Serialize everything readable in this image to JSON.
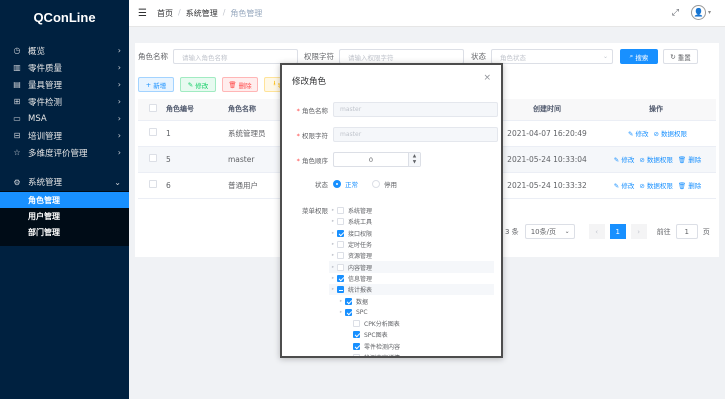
{
  "app": {
    "title": "QConLine"
  },
  "sidebar": {
    "items": [
      {
        "label": "概览",
        "icon": "dashboard-icon"
      },
      {
        "label": "零件质量",
        "icon": "chart-icon"
      },
      {
        "label": "量具管理",
        "icon": "ruler-icon"
      },
      {
        "label": "零件检测",
        "icon": "inspect-icon"
      },
      {
        "label": "MSA",
        "icon": "msa-icon"
      },
      {
        "label": "培训管理",
        "icon": "training-icon"
      },
      {
        "label": "多维度评价管理",
        "icon": "star-icon"
      }
    ],
    "system": {
      "label": "系统管理",
      "icon": "gear-icon"
    },
    "sub_items": [
      {
        "label": "角色管理",
        "active": true
      },
      {
        "label": "用户管理",
        "active": false
      },
      {
        "label": "部门管理",
        "active": false
      }
    ]
  },
  "header": {
    "breadcrumb": [
      "首页",
      "系统管理",
      "角色管理"
    ],
    "separator": "/"
  },
  "search": {
    "role_name_label": "角色名称",
    "role_name_placeholder": "请输入角色名称",
    "perm_label": "权限字符",
    "perm_placeholder": "请输入权限字符",
    "status_label": "状态",
    "status_placeholder": "角色状态",
    "search_btn": "搜索",
    "reset_btn": "重置"
  },
  "toolbar": {
    "add": "新增",
    "edit": "修改",
    "delete": "删除",
    "export": "导出"
  },
  "table": {
    "headers": [
      "角色编号",
      "角色名称",
      "创建时间",
      "操作"
    ],
    "rows": [
      {
        "id": "1",
        "name": "系统管理员",
        "created": "2021-04-07 16:20:49",
        "ops": [
          "修改",
          "数据权限"
        ]
      },
      {
        "id": "5",
        "name": "master",
        "created": "2021-05-24 10:33:04",
        "ops": [
          "修改",
          "数据权限",
          "删除"
        ]
      },
      {
        "id": "6",
        "name": "普通用户",
        "created": "2021-05-24 10:33:32",
        "ops": [
          "修改",
          "数据权限",
          "删除"
        ]
      }
    ]
  },
  "pager": {
    "total": "3 条",
    "size": "10条/页",
    "page": "1",
    "goto": "前往",
    "goto_val": "1",
    "unit": "页"
  },
  "dialog": {
    "title": "修改角色",
    "close": "×",
    "fields": {
      "name_label": "角色名称",
      "name_value": "master",
      "perm_label": "权限字符",
      "perm_value": "master",
      "order_label": "角色顺序",
      "order_value": "0",
      "status_label": "状态",
      "status_on": "正常",
      "status_off": "停用",
      "menu_label": "菜单权限"
    },
    "tree": [
      {
        "label": "系统管理",
        "state": "off",
        "caret": true,
        "indent": 0,
        "hl": false
      },
      {
        "label": "系统工具",
        "state": "off",
        "caret": true,
        "indent": 0,
        "hl": false
      },
      {
        "label": "接口权限",
        "state": "on",
        "caret": true,
        "indent": 0,
        "hl": false
      },
      {
        "label": "定时任务",
        "state": "off",
        "caret": true,
        "indent": 0,
        "hl": false
      },
      {
        "label": "资源管理",
        "state": "off",
        "caret": true,
        "indent": 0,
        "hl": false
      },
      {
        "label": "内容管理",
        "state": "off",
        "caret": true,
        "indent": 0,
        "hl": true
      },
      {
        "label": "信息管理",
        "state": "on",
        "caret": true,
        "indent": 0,
        "hl": false
      },
      {
        "label": "统计报表",
        "state": "half",
        "caret": true,
        "indent": 0,
        "hl": true
      },
      {
        "label": "数据",
        "state": "on",
        "caret": true,
        "indent": 1,
        "hl": false
      },
      {
        "label": "SPC",
        "state": "on",
        "caret": true,
        "indent": 1,
        "hl": false
      },
      {
        "label": "CPK分析图表",
        "state": "off",
        "caret": false,
        "indent": 2,
        "hl": false
      },
      {
        "label": "SPC图表",
        "state": "on",
        "caret": false,
        "indent": 2,
        "hl": false
      },
      {
        "label": "零件检测内容",
        "state": "on",
        "caret": false,
        "indent": 2,
        "hl": false
      },
      {
        "label": "检测内容详情",
        "state": "off",
        "caret": false,
        "indent": 2,
        "hl": false
      }
    ]
  }
}
